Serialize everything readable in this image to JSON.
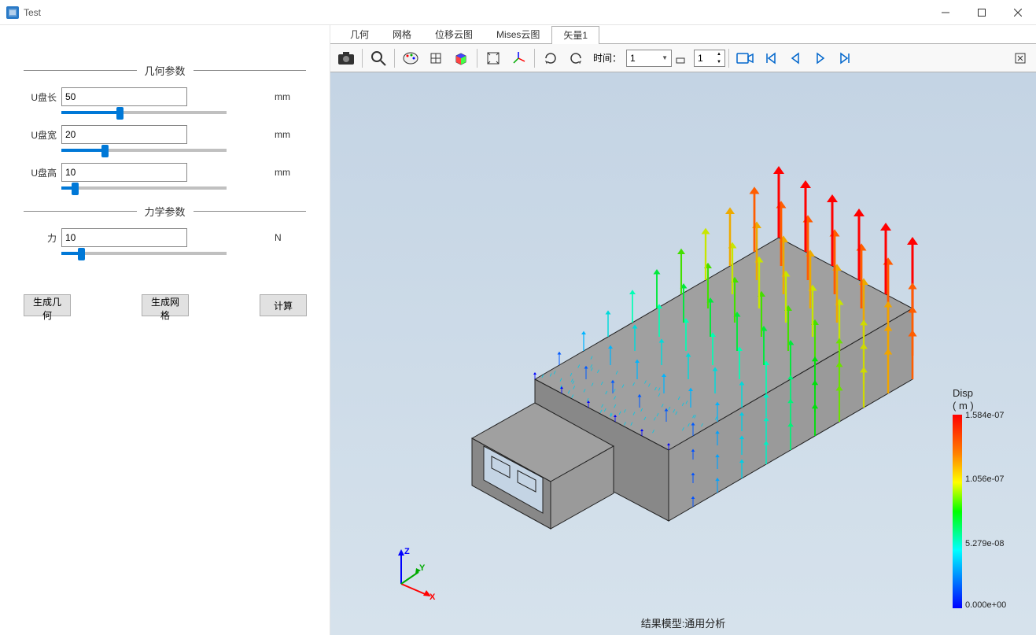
{
  "window": {
    "title": "Test"
  },
  "sidebar": {
    "section_geom": "几何参数",
    "section_force": "力学参数",
    "params": {
      "length": {
        "label": "U盘长",
        "value": "50",
        "unit": "mm",
        "slider_pct": 35
      },
      "width": {
        "label": "U盘宽",
        "value": "20",
        "unit": "mm",
        "slider_pct": 26
      },
      "height": {
        "label": "U盘高",
        "value": "10",
        "unit": "mm",
        "slider_pct": 8
      },
      "force": {
        "label": "力",
        "value": "10",
        "unit": "N",
        "slider_pct": 12
      }
    },
    "buttons": {
      "gen_geom": "生成几何",
      "gen_mesh": "生成网格",
      "compute": "计算"
    }
  },
  "tabs": {
    "items": [
      "几何",
      "网格",
      "位移云图",
      "Mises云图",
      "矢量1"
    ],
    "active": 4
  },
  "toolbar": {
    "time_label": "时间：",
    "time_value": "1",
    "step_value": "1"
  },
  "legend": {
    "title_line1": "Disp",
    "title_line2": "( m )",
    "ticks": [
      "1.584e-07",
      "1.056e-07",
      "5.279e-08",
      "0.000e+00"
    ]
  },
  "footer": "结果模型:通用分析",
  "triad": {
    "x": "X",
    "y": "Y",
    "z": "Z"
  },
  "chart_data": {
    "type": "vector_field_colorbar",
    "quantity": "Disp",
    "unit": "m",
    "range": [
      0.0,
      1.584e-07
    ],
    "ticks": [
      0.0,
      5.279e-08,
      1.056e-07,
      1.584e-07
    ],
    "colormap": "rainbow (blue→cyan→green→yellow→orange→red)"
  }
}
